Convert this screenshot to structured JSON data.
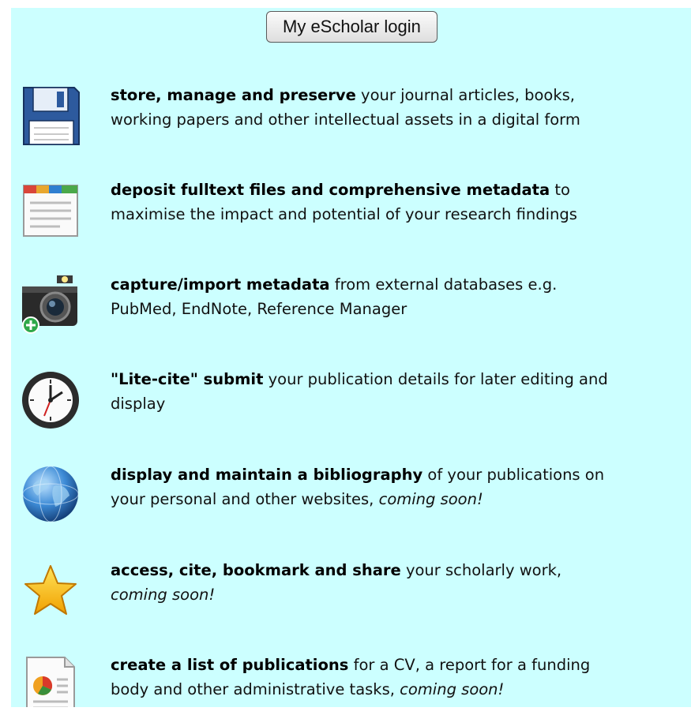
{
  "login_button": {
    "label": "My eScholar login"
  },
  "features": [
    {
      "icon": "floppy-disk-icon",
      "bold": "store, manage and preserve",
      "line1_rest": " your journal articles, books,",
      "line2": "working papers and other intellectual assets in a digital form",
      "coming_soon": ""
    },
    {
      "icon": "browser-window-icon",
      "bold": "deposit fulltext files and comprehensive metadata",
      "line1_rest": " to",
      "line2": "maximise the impact and potential of your research findings",
      "coming_soon": ""
    },
    {
      "icon": "camera-add-icon",
      "bold": "capture/import metadata",
      "line1_rest": " from external databases e.g.",
      "line2": "PubMed, EndNote, Reference Manager",
      "coming_soon": ""
    },
    {
      "icon": "clock-icon",
      "bold": "\"Lite-cite\" submit",
      "line1_rest": " your publication details for later editing and",
      "line2": "display",
      "coming_soon": ""
    },
    {
      "icon": "globe-icon",
      "bold": "display and maintain a bibliography",
      "line1_rest": " of your publications on",
      "line2": "your personal and other websites, ",
      "coming_soon": "coming soon!"
    },
    {
      "icon": "star-icon",
      "bold": "access, cite, bookmark and share",
      "line1_rest": " your scholarly work,",
      "line2": "",
      "coming_soon": "coming soon!"
    },
    {
      "icon": "report-document-icon",
      "bold": "create a list of publications",
      "line1_rest": " for a CV, a report for a funding",
      "line2": "body and other administrative tasks, ",
      "coming_soon": "coming soon!"
    }
  ]
}
